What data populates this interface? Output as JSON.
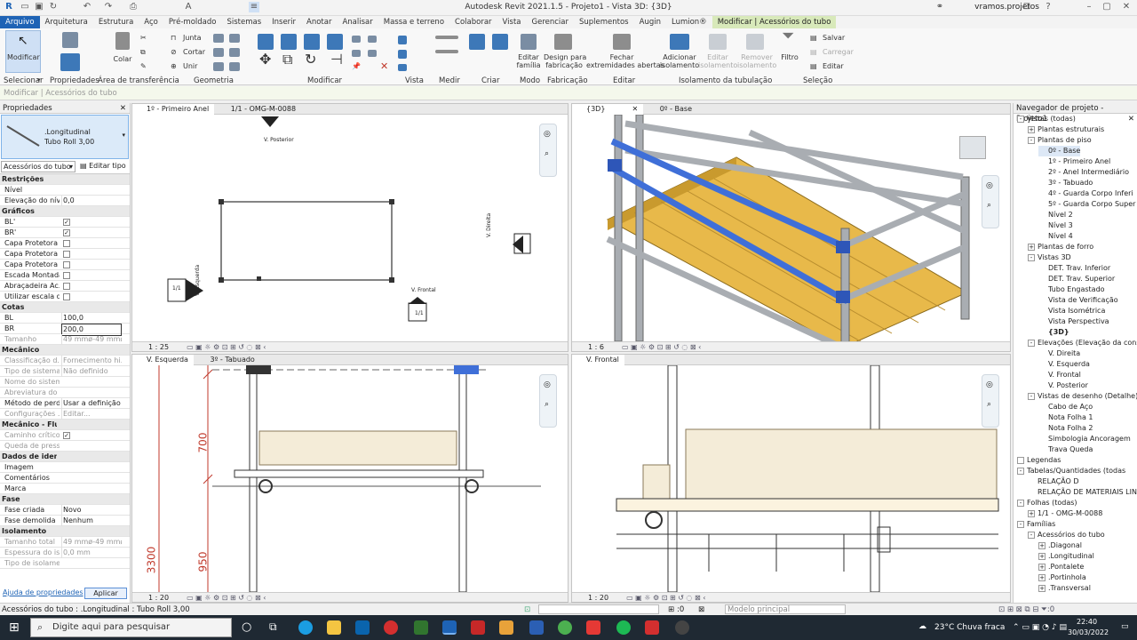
{
  "window": {
    "title": "Autodesk Revit 2021.1.5 - Projeto1 - Vista 3D: {3D}",
    "user": "vramos.projetos"
  },
  "menu": {
    "tabs": [
      "Arquivo",
      "Arquitetura",
      "Estrutura",
      "Aço",
      "Pré-moldado",
      "Sistemas",
      "Inserir",
      "Anotar",
      "Analisar",
      "Massa e terreno",
      "Colaborar",
      "Vista",
      "Gerenciar",
      "Suplementos",
      "Augin",
      "Lumion®",
      "Modificar | Acessórios do tubo"
    ]
  },
  "ribbon": {
    "modify": "Modificar",
    "paste": "Colar",
    "join": "Junta",
    "cut": "Cortar",
    "unite": "Unir",
    "edit_family": "Editar\nfamília",
    "design_fabrication": "Design para\nfabricação",
    "close_open_ends": "Fechar\nextremidades abertas",
    "add_insulation": "Adicionar\nisolamento",
    "edit_insulation": "Editar\nisolamento",
    "remove_insulation": "Remover\nisolamento",
    "filter": "Filtro",
    "save": "Salvar",
    "load": "Carregar",
    "edit": "Editar",
    "groups": {
      "select": "Selecionar",
      "properties": "Propriedades",
      "clipboard": "Área de transferência",
      "geometry": "Geometria",
      "modify": "Modificar",
      "view": "Vista",
      "measure": "Medir",
      "create": "Criar",
      "mode": "Modo",
      "fabrication": "Fabricação",
      "edit": "Editar",
      "insulation": "Isolamento da tubulação",
      "selection": "Seleção"
    }
  },
  "optionsbar": "Modificar | Acessórios do tubo",
  "properties": {
    "title": "Propriedades",
    "type_name": ".Longitudinal",
    "type_sub": "Tubo Roll  3,00",
    "selector": "Acessórios do tubo",
    "edit_type": "Editar tipo",
    "rows": [
      {
        "k": "Restrições",
        "cat": true
      },
      {
        "k": "Nível",
        "v": ""
      },
      {
        "k": "Elevação do nível",
        "v": "0,0"
      },
      {
        "k": "Gráficos",
        "cat": true
      },
      {
        "k": "BL'",
        "chk": "✓"
      },
      {
        "k": "BR'",
        "chk": "✓"
      },
      {
        "k": "Capa Protetora A",
        "chk": ""
      },
      {
        "k": "Capa Protetora B",
        "chk": ""
      },
      {
        "k": "Capa Protetora ...",
        "chk": ""
      },
      {
        "k": "Escada Montada",
        "chk": ""
      },
      {
        "k": "Abraçadeira Ac...",
        "chk": ""
      },
      {
        "k": "Utilizar escala d...",
        "chk": ""
      },
      {
        "k": "Cotas",
        "cat": true
      },
      {
        "k": "BL",
        "v": "100,0"
      },
      {
        "k": "BR",
        "v": "200,0"
      },
      {
        "k": "Tamanho",
        "v": "49 mmø-49 mmø",
        "dis": true
      },
      {
        "k": "Mecânico",
        "cat": true
      },
      {
        "k": "Classificação d...",
        "v": "Fornecimento hi...",
        "dis": true
      },
      {
        "k": "Tipo de sistema",
        "v": "Não definido",
        "dis": true
      },
      {
        "k": "Nome do sistema",
        "v": "",
        "dis": true
      },
      {
        "k": "Abreviatura do ...",
        "v": "",
        "dis": true
      },
      {
        "k": "Método de perda",
        "v": "Usar a definição ..."
      },
      {
        "k": "Configurações ...",
        "v": "Editar...",
        "dis": true
      },
      {
        "k": "Mecânico - Fluxo",
        "cat": true
      },
      {
        "k": "Caminho crítico",
        "chk": "✓",
        "dis": true
      },
      {
        "k": "Queda de pressão",
        "v": "",
        "dis": true
      },
      {
        "k": "Dados de identidade",
        "cat": true
      },
      {
        "k": "Imagem",
        "v": ""
      },
      {
        "k": "Comentários",
        "v": ""
      },
      {
        "k": "Marca",
        "v": ""
      },
      {
        "k": "Fase",
        "cat": true
      },
      {
        "k": "Fase criada",
        "v": "Novo"
      },
      {
        "k": "Fase demolida",
        "v": "Nenhum"
      },
      {
        "k": "Isolamento",
        "cat": true
      },
      {
        "k": "Tamanho total",
        "v": "49 mmø-49 mmø",
        "dis": true
      },
      {
        "k": "Espessura do is...",
        "v": "0,0 mm",
        "dis": true
      },
      {
        "k": "Tipo de isolame...",
        "v": "",
        "dis": true
      }
    ],
    "help": "Ajuda de propriedades",
    "apply": "Aplicar"
  },
  "views": {
    "tl": {
      "tabs": [
        "1º - Primeiro Anel",
        "1/1 - OMG-M-0088"
      ],
      "scale": "1 : 25",
      "labels": {
        "posterior": "V. Posterior",
        "direita": "V. Direita",
        "esquerda": "V. Esquerda",
        "frontal": "V. Frontal",
        "sheet": "1/1",
        "dash": "-"
      }
    },
    "tr": {
      "tabs": [
        "{3D}",
        "0º - Base"
      ],
      "scale": "1 : 6"
    },
    "bl": {
      "tabs": [
        "V. Esquerda",
        "3º - Tabuado"
      ],
      "scale": "1 : 20",
      "dims": [
        "700",
        "950",
        "3300"
      ]
    },
    "br": {
      "tabs": [
        "V. Frontal"
      ],
      "scale": "1 : 20"
    }
  },
  "navigator": {
    "title": "Navegador de projeto - Projeto1",
    "items": [
      {
        "t": "Vistas (todas)",
        "l": 0,
        "e": "-"
      },
      {
        "t": "Plantas estruturais",
        "l": 1,
        "e": "+"
      },
      {
        "t": "Plantas de piso",
        "l": 1,
        "e": "-"
      },
      {
        "t": "0º - Base",
        "l": 2,
        "sel": true
      },
      {
        "t": "1º - Primeiro Anel",
        "l": 2
      },
      {
        "t": "2º - Anel Intermediário",
        "l": 2
      },
      {
        "t": "3º - Tabuado",
        "l": 2
      },
      {
        "t": "4º - Guarda Corpo Inferi",
        "l": 2
      },
      {
        "t": "5º - Guarda Corpo Super",
        "l": 2
      },
      {
        "t": "Nível 2",
        "l": 2
      },
      {
        "t": "Nível 3",
        "l": 2
      },
      {
        "t": "Nível 4",
        "l": 2
      },
      {
        "t": "Plantas de forro",
        "l": 1,
        "e": "+"
      },
      {
        "t": "Vistas 3D",
        "l": 1,
        "e": "-"
      },
      {
        "t": "DET. Trav. Inferior",
        "l": 2
      },
      {
        "t": "DET. Trav. Superior",
        "l": 2
      },
      {
        "t": "Tubo Engastado",
        "l": 2
      },
      {
        "t": "Vista de Verificação",
        "l": 2
      },
      {
        "t": "Vista Isométrica",
        "l": 2
      },
      {
        "t": "Vista Perspectiva",
        "l": 2
      },
      {
        "t": "{3D}",
        "l": 2,
        "bold": true
      },
      {
        "t": "Elevações (Elevação da cons",
        "l": 1,
        "e": "-"
      },
      {
        "t": "V. Direita",
        "l": 2
      },
      {
        "t": "V. Esquerda",
        "l": 2
      },
      {
        "t": "V. Frontal",
        "l": 2
      },
      {
        "t": "V. Posterior",
        "l": 2
      },
      {
        "t": "Vistas de desenho (Detalhe)",
        "l": 1,
        "e": "-"
      },
      {
        "t": "Cabo de Aço",
        "l": 2
      },
      {
        "t": "Nota Folha 1",
        "l": 2
      },
      {
        "t": "Nota Folha 2",
        "l": 2
      },
      {
        "t": "Simbologia Ancoragem",
        "l": 2
      },
      {
        "t": "Trava Queda",
        "l": 2
      },
      {
        "t": "Legendas",
        "l": 0,
        "e": ""
      },
      {
        "t": "Tabelas/Quantidades (todas",
        "l": 0,
        "e": "-"
      },
      {
        "t": "RELAÇÃO D",
        "l": 1
      },
      {
        "t": "RELAÇÃO DE MATERIAIS LIN",
        "l": 1
      },
      {
        "t": "Folhas (todas)",
        "l": 0,
        "e": "-"
      },
      {
        "t": "1/1 - OMG-M-0088",
        "l": 1,
        "e": "+"
      },
      {
        "t": "Famílias",
        "l": 0,
        "e": "-"
      },
      {
        "t": "Acessórios do tubo",
        "l": 1,
        "e": "-"
      },
      {
        "t": ".Diagonal",
        "l": 2,
        "e": "+"
      },
      {
        "t": ".Longitudinal",
        "l": 2,
        "e": "+"
      },
      {
        "t": ".Pontalete",
        "l": 2,
        "e": "+"
      },
      {
        "t": ".Portinhola",
        "l": 2,
        "e": "+"
      },
      {
        "t": ".Transversal",
        "l": 2,
        "e": "+"
      }
    ]
  },
  "status": {
    "left": "Acessórios do tubo : .Longitudinal : Tubo Roll  3,00",
    "zero": ":0",
    "model": "Modelo principal"
  },
  "taskbar": {
    "search": "Digite aqui para pesquisar",
    "weather": "23°C  Chuva fraca",
    "time": "22:40",
    "date": "30/03/2022"
  },
  "colors": {
    "accent": "#1e63b5",
    "ribbon_active": "#d8e9ba",
    "selection_blue": "#3f6fd8",
    "plank": "#e8b94a"
  }
}
